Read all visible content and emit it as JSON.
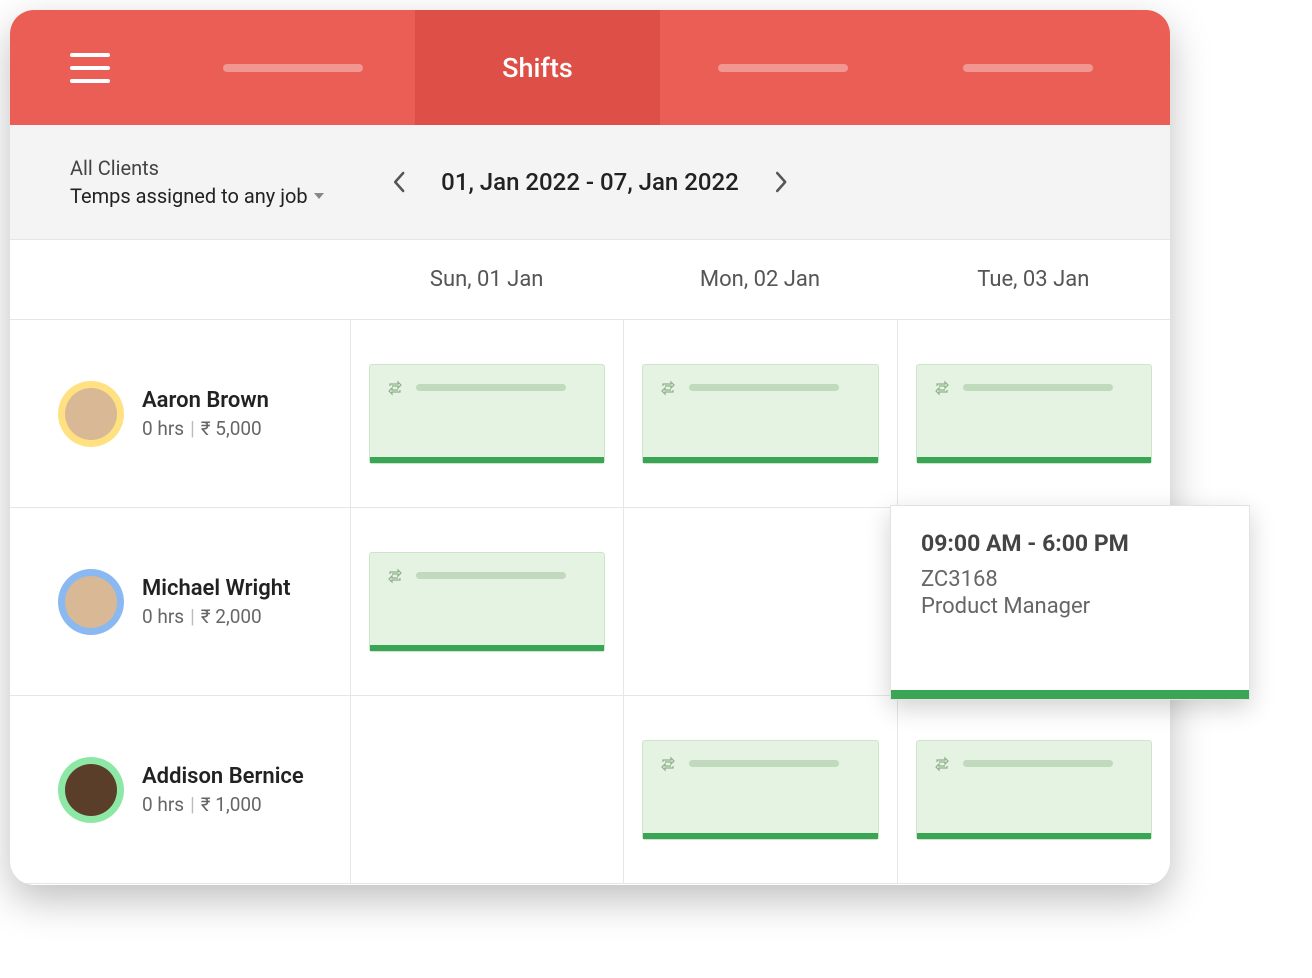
{
  "header": {
    "active_tab_label": "Shifts"
  },
  "subheader": {
    "clients_filter": "All Clients",
    "temps_filter": "Temps assigned to any job",
    "date_range": "01, Jan 2022 - 07, Jan 2022"
  },
  "day_headers": [
    "Sun, 01 Jan",
    "Mon, 02 Jan",
    "Tue, 03 Jan"
  ],
  "people": [
    {
      "name": "Aaron Brown",
      "hours": "0 hrs",
      "amount": "₹ 5,000",
      "avatar_color": "yellow",
      "shifts": [
        true,
        true,
        true
      ]
    },
    {
      "name": "Michael Wright",
      "hours": "0 hrs",
      "amount": "₹ 2,000",
      "avatar_color": "blue",
      "shifts": [
        true,
        false,
        false
      ]
    },
    {
      "name": "Addison Bernice",
      "hours": "0 hrs",
      "amount": "₹ 1,000",
      "avatar_color": "green",
      "shifts": [
        false,
        true,
        true
      ]
    }
  ],
  "popover": {
    "time": "09:00 AM - 6:00 PM",
    "code": "ZC3168",
    "role": "Product Manager"
  }
}
